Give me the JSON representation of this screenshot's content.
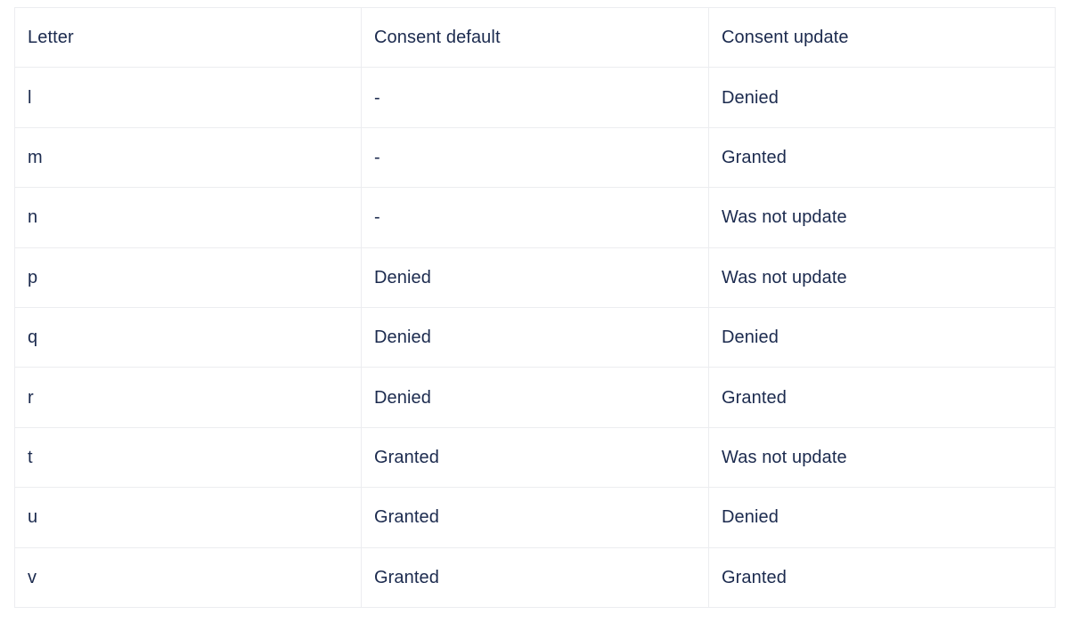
{
  "table": {
    "columns": [
      {
        "key": "letter",
        "label": "Letter"
      },
      {
        "key": "default",
        "label": "Consent default"
      },
      {
        "key": "update",
        "label": "Consent update"
      }
    ],
    "rows": [
      {
        "letter": "l",
        "default": "-",
        "update": "Denied"
      },
      {
        "letter": "m",
        "default": "-",
        "update": "Granted"
      },
      {
        "letter": "n",
        "default": "-",
        "update": "Was not update"
      },
      {
        "letter": "p",
        "default": "Denied",
        "update": "Was not update"
      },
      {
        "letter": "q",
        "default": "Denied",
        "update": "Denied"
      },
      {
        "letter": "r",
        "default": "Denied",
        "update": "Granted"
      },
      {
        "letter": "t",
        "default": "Granted",
        "update": "Was not update"
      },
      {
        "letter": "u",
        "default": "Granted",
        "update": "Denied"
      },
      {
        "letter": "v",
        "default": "Granted",
        "update": "Granted"
      }
    ]
  },
  "style": {
    "text_color": "#1b2a4e",
    "border_color": "#ecedf0",
    "background_color": "#ffffff"
  }
}
